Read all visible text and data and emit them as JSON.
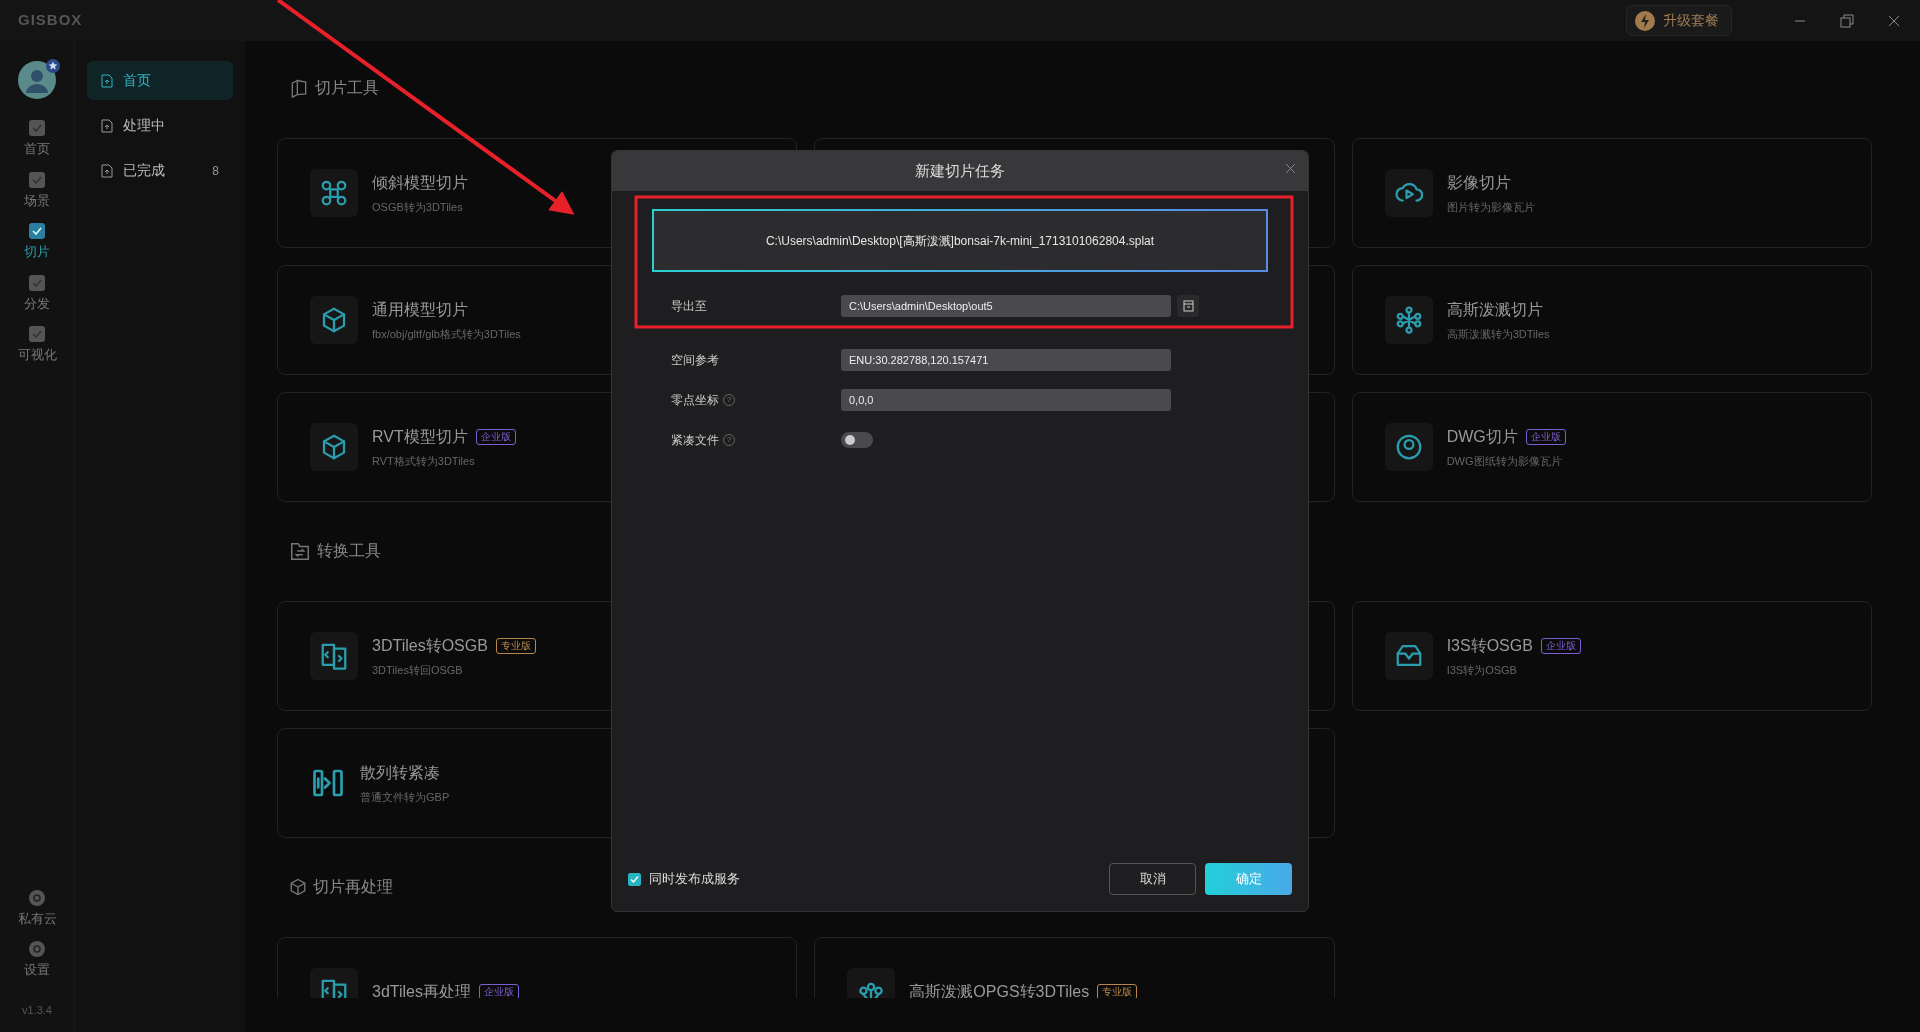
{
  "app": {
    "logo": "GISBOX",
    "upgrade": "升级套餐",
    "version": "v1.3.4"
  },
  "rail": [
    {
      "label": "首页",
      "selected": false
    },
    {
      "label": "场景",
      "selected": false
    },
    {
      "label": "切片",
      "selected": true
    },
    {
      "label": "分发",
      "selected": false
    },
    {
      "label": "可视化",
      "selected": false
    }
  ],
  "rail_bottom": [
    {
      "label": "私有云"
    },
    {
      "label": "设置"
    }
  ],
  "subnav": [
    {
      "label": "首页",
      "selected": true
    },
    {
      "label": "处理中",
      "selected": false
    },
    {
      "label": "已完成",
      "count": "8",
      "selected": false
    }
  ],
  "sections": [
    {
      "title": "切片工具",
      "cards": [
        {
          "title": "倾斜模型切片",
          "subtitle": "OSGB转为3DTiles"
        },
        {
          "title": "影像切片",
          "subtitle": "图片转为影像瓦片"
        },
        {
          "title": "通用模型切片",
          "subtitle": "fbx/obj/gltf/glb格式转为3DTiles"
        },
        {
          "title": "高斯泼溅切片",
          "subtitle": "高斯泼溅转为3DTiles"
        },
        {
          "title": "RVT模型切片",
          "subtitle": "RVT格式转为3DTiles",
          "badge": {
            "text": "企业版",
            "color": "#7c5fd0"
          }
        },
        {
          "title": "DWG切片",
          "subtitle": "DWG图纸转为影像瓦片",
          "badge": {
            "text": "企业版",
            "color": "#7c5fd0"
          }
        }
      ]
    },
    {
      "title": "转换工具",
      "cards": [
        {
          "title": "3DTiles转OSGB",
          "subtitle": "3DTiles转回OSGB",
          "badge": {
            "text": "专业版",
            "color": "#b8864b"
          }
        },
        {
          "title": "I3S转OSGB",
          "subtitle": "I3S转为OSGB",
          "badge": {
            "text": "企业版",
            "color": "#7c5fd0"
          }
        },
        {
          "title": "散列转紧凑",
          "subtitle": "普通文件转为GBP"
        }
      ]
    },
    {
      "title": "切片再处理",
      "cards": [
        {
          "title": "3dTiles再处理",
          "badge": {
            "text": "企业版",
            "color": "#7c5fd0"
          }
        },
        {
          "title": "高斯泼溅OPGS转3DTiles",
          "badge": {
            "text": "专业版",
            "color": "#b8864b"
          }
        }
      ]
    }
  ],
  "dialog": {
    "title": "新建切片任务",
    "source": "C:\\Users\\admin\\Desktop\\[高斯泼溅]bonsai-7k-mini_1713101062804.splat",
    "fields": [
      {
        "kind": "path",
        "label": "导出至",
        "value": "C:\\Users\\admin\\Desktop\\out5"
      },
      {
        "kind": "text",
        "label": "空间参考",
        "value": "ENU:30.282788,120.157471"
      },
      {
        "kind": "text",
        "label": "零点坐标",
        "help": "?",
        "value": "0,0,0"
      },
      {
        "kind": "switch",
        "label": "紧凑文件",
        "help": "?",
        "on": false
      }
    ],
    "publish": {
      "label": "同时发布成服务",
      "checked": true
    },
    "buttons": [
      {
        "kind": "secondary",
        "label": "取消"
      },
      {
        "kind": "primary",
        "label": "确定"
      }
    ]
  }
}
